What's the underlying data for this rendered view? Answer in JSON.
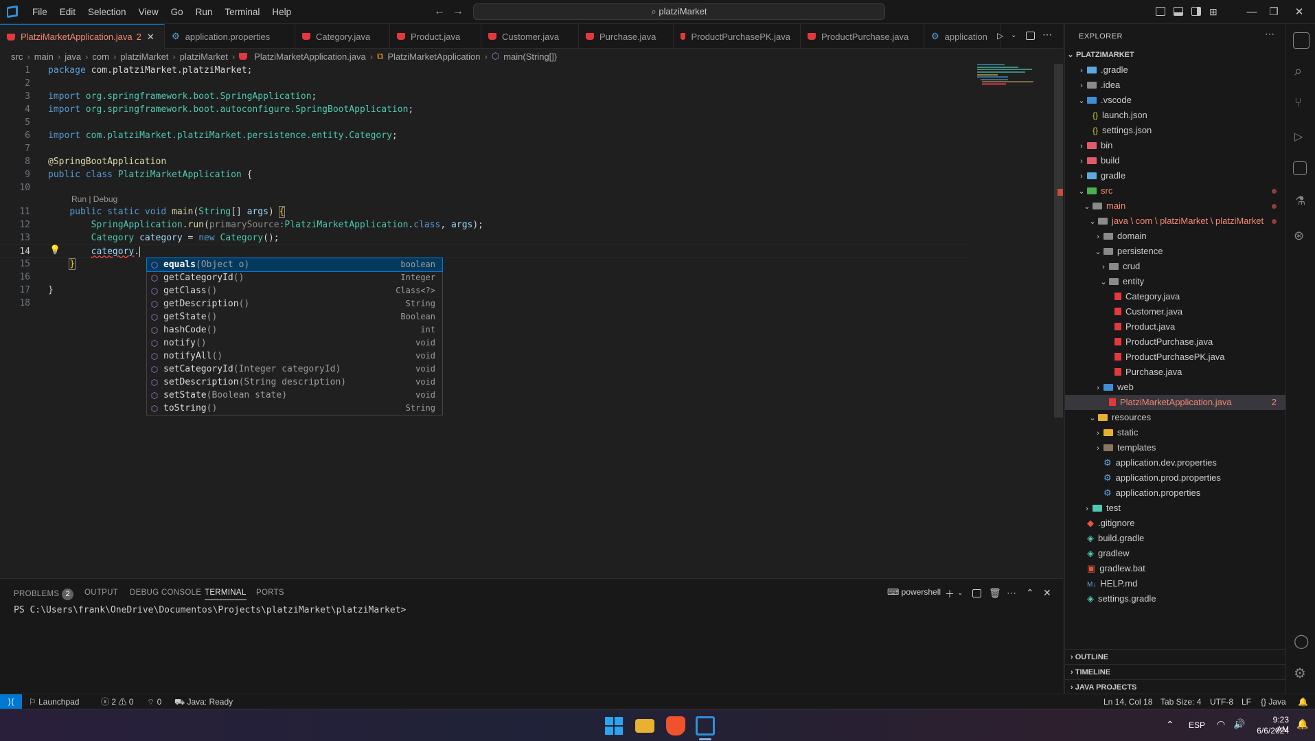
{
  "menu": [
    "File",
    "Edit",
    "Selection",
    "View",
    "Go",
    "Run",
    "Terminal",
    "Help"
  ],
  "command_center": {
    "text": "platziMarket"
  },
  "tabs": [
    {
      "label": "PlatziMarketApplication.java",
      "badge": "2",
      "icon": "java-icon",
      "active": true
    },
    {
      "label": "application.properties",
      "icon": "gear-icon"
    },
    {
      "label": "Category.java",
      "icon": "java-icon"
    },
    {
      "label": "Product.java",
      "icon": "java-icon"
    },
    {
      "label": "Customer.java",
      "icon": "java-icon"
    },
    {
      "label": "Purchase.java",
      "icon": "java-icon"
    },
    {
      "label": "ProductPurchasePK.java",
      "icon": "java-icon"
    },
    {
      "label": "ProductPurchase.java",
      "icon": "java-icon"
    },
    {
      "label": "application",
      "icon": "gear-icon"
    }
  ],
  "breadcrumb": [
    "src",
    "main",
    "java",
    "com",
    "platziMarket",
    "platziMarket",
    "PlatziMarketApplication.java",
    "PlatziMarketApplication",
    "main(String[])"
  ],
  "editor": {
    "line_numbers": [
      "1",
      "2",
      "3",
      "4",
      "5",
      "6",
      "7",
      "8",
      "9",
      "10",
      "11",
      "12",
      "13",
      "14",
      "15",
      "16",
      "17",
      "18"
    ],
    "codelens": "Run | Debug",
    "current_line": "14"
  },
  "suggestions": [
    {
      "name": "equals",
      "args": "(Object o)",
      "type": "boolean",
      "selected": true
    },
    {
      "name": "getCategoryId",
      "args": "()",
      "type": "Integer"
    },
    {
      "name": "getClass",
      "args": "()",
      "type": "Class<?>"
    },
    {
      "name": "getDescription",
      "args": "()",
      "type": "String"
    },
    {
      "name": "getState",
      "args": "()",
      "type": "Boolean"
    },
    {
      "name": "hashCode",
      "args": "()",
      "type": "int"
    },
    {
      "name": "notify",
      "args": "()",
      "type": "void"
    },
    {
      "name": "notifyAll",
      "args": "()",
      "type": "void"
    },
    {
      "name": "setCategoryId",
      "args": "(Integer categoryId)",
      "type": "void"
    },
    {
      "name": "setDescription",
      "args": "(String description)",
      "type": "void"
    },
    {
      "name": "setState",
      "args": "(Boolean state)",
      "type": "void"
    },
    {
      "name": "toString",
      "args": "()",
      "type": "String"
    }
  ],
  "panel": {
    "tabs": {
      "problems": "PROBLEMS",
      "problems_count": "2",
      "output": "OUTPUT",
      "debug": "DEBUG CONSOLE",
      "terminal": "TERMINAL",
      "ports": "PORTS"
    },
    "shell": "powershell",
    "prompt": "PS C:\\Users\\frank\\OneDrive\\Documentos\\Projects\\platziMarket\\platziMarket>"
  },
  "explorer": {
    "title": "EXPLORER",
    "root": "PLATZIMARKET",
    "items": [
      {
        "label": ".gradle",
        "depth": 1,
        "kind": "folder",
        "chev": "›",
        "color": "#5da8e0"
      },
      {
        "label": ".idea",
        "depth": 1,
        "kind": "folder",
        "chev": "›",
        "color": "#8a8a8a"
      },
      {
        "label": ".vscode",
        "depth": 1,
        "kind": "folder",
        "chev": "⌄",
        "color": "#3d8fd6"
      },
      {
        "label": "launch.json",
        "depth": 2,
        "kind": "json"
      },
      {
        "label": "settings.json",
        "depth": 2,
        "kind": "json"
      },
      {
        "label": "bin",
        "depth": 1,
        "kind": "folder",
        "chev": "›",
        "color": "#e05a6b"
      },
      {
        "label": "build",
        "depth": 1,
        "kind": "folder",
        "chev": "›",
        "color": "#e05a6b"
      },
      {
        "label": "gradle",
        "depth": 1,
        "kind": "folder",
        "chev": "›",
        "color": "#5da8e0"
      },
      {
        "label": "src",
        "depth": 1,
        "kind": "folder",
        "chev": "⌄",
        "color": "#4caf50",
        "err": true,
        "dot": true
      },
      {
        "label": "main",
        "depth": 2,
        "kind": "folder",
        "chev": "⌄",
        "color": "#8a8a8a",
        "err": true,
        "dot": true
      },
      {
        "label": "java \\ com \\ platziMarket \\ platziMarket",
        "depth": 3,
        "kind": "folder",
        "chev": "⌄",
        "color": "#8a8a8a",
        "err": true,
        "dot": true
      },
      {
        "label": "domain",
        "depth": 4,
        "kind": "folder",
        "chev": "›",
        "color": "#8a8a8a"
      },
      {
        "label": "persistence",
        "depth": 4,
        "kind": "folder",
        "chev": "⌄",
        "color": "#8a8a8a"
      },
      {
        "label": "crud",
        "depth": 5,
        "kind": "folder",
        "chev": "›",
        "color": "#8a8a8a"
      },
      {
        "label": "entity",
        "depth": 5,
        "kind": "folder",
        "chev": "⌄",
        "color": "#8a8a8a"
      },
      {
        "label": "Category.java",
        "depth": 6,
        "kind": "java"
      },
      {
        "label": "Customer.java",
        "depth": 6,
        "kind": "java"
      },
      {
        "label": "Product.java",
        "depth": 6,
        "kind": "java"
      },
      {
        "label": "ProductPurchase.java",
        "depth": 6,
        "kind": "java"
      },
      {
        "label": "ProductPurchasePK.java",
        "depth": 6,
        "kind": "java"
      },
      {
        "label": "Purchase.java",
        "depth": 6,
        "kind": "java"
      },
      {
        "label": "web",
        "depth": 4,
        "kind": "folder",
        "chev": "›",
        "color": "#3d8fd6"
      },
      {
        "label": "PlatziMarketApplication.java",
        "depth": 5,
        "kind": "java",
        "err": true,
        "num": "2",
        "selected": true
      },
      {
        "label": "resources",
        "depth": 3,
        "kind": "folder",
        "chev": "⌄",
        "color": "#e8b130"
      },
      {
        "label": "static",
        "depth": 4,
        "kind": "folder",
        "chev": "›",
        "color": "#e8b130"
      },
      {
        "label": "templates",
        "depth": 4,
        "kind": "folder",
        "chev": "›",
        "color": "#8a7560"
      },
      {
        "label": "application.dev.properties",
        "depth": 4,
        "kind": "gear"
      },
      {
        "label": "application.prod.properties",
        "depth": 4,
        "kind": "gear"
      },
      {
        "label": "application.properties",
        "depth": 4,
        "kind": "gear"
      },
      {
        "label": "test",
        "depth": 2,
        "kind": "folder",
        "chev": "›",
        "color": "#4ec9b0"
      },
      {
        "label": ".gitignore",
        "depth": 1,
        "kind": "git"
      },
      {
        "label": "build.gradle",
        "depth": 1,
        "kind": "gradle"
      },
      {
        "label": "gradlew",
        "depth": 1,
        "kind": "gradle"
      },
      {
        "label": "gradlew.bat",
        "depth": 1,
        "kind": "bat"
      },
      {
        "label": "HELP.md",
        "depth": 1,
        "kind": "md"
      },
      {
        "label": "settings.gradle",
        "depth": 1,
        "kind": "gradle"
      }
    ],
    "sections": [
      "OUTLINE",
      "TIMELINE",
      "JAVA PROJECTS"
    ]
  },
  "status": {
    "launchpad": "Launchpad",
    "errors": "2",
    "warnings": "0",
    "ports": "0",
    "java": "Java: Ready",
    "position": "Ln 14, Col 18",
    "tab_size": "Tab Size: 4",
    "encoding": "UTF-8",
    "eol": "LF",
    "language": "Java"
  },
  "taskbar": {
    "lang": "ESP",
    "time": "9:23 AM",
    "date": "6/6/2024"
  },
  "colors": {
    "accent": "#0078d4",
    "error": "#f48771",
    "java": "#e3393c"
  }
}
